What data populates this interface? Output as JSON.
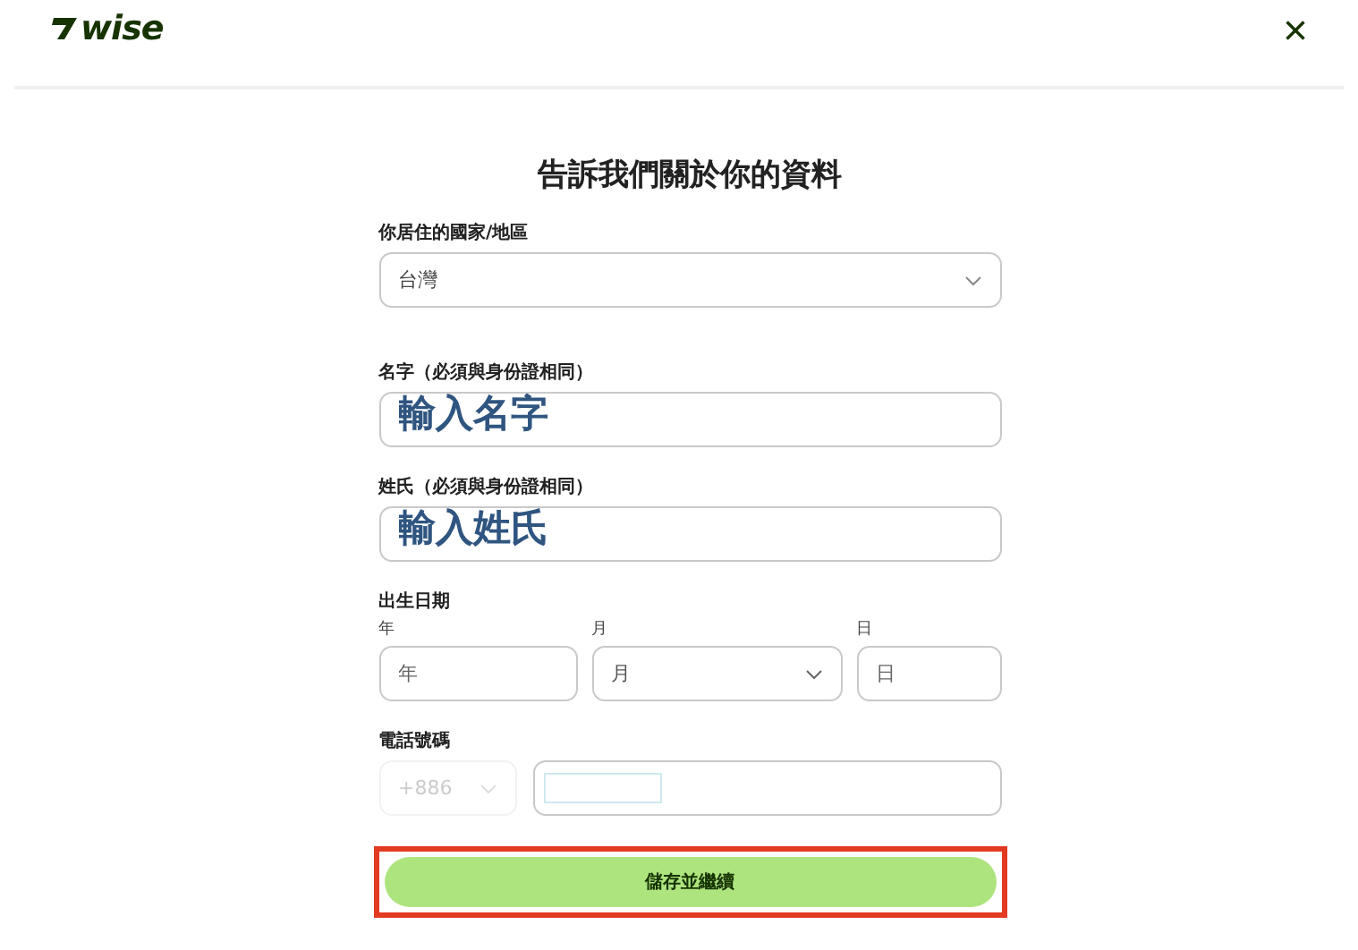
{
  "header": {
    "logo": "wise",
    "close": "×"
  },
  "title": "告訴我們關於你的資料",
  "country": {
    "label": "你居住的國家/地區",
    "value": "台灣"
  },
  "first_name": {
    "label": "名字（必須與身份證相同）",
    "placeholder": "輸入名字"
  },
  "last_name": {
    "label": "姓氏（必須與身份證相同）",
    "placeholder": "輸入姓氏"
  },
  "birth_date": {
    "label": "出生日期",
    "parts": [
      {
        "kind": "input",
        "label": "年",
        "placeholder": "年"
      },
      {
        "kind": "select",
        "label": "月",
        "placeholder": "月"
      },
      {
        "kind": "input",
        "label": "日",
        "placeholder": "日"
      }
    ]
  },
  "phone": {
    "label": "電話號碼",
    "code": "+886",
    "code_disabled": true
  },
  "submit": {
    "label": "儲存並繼續",
    "highlighted": true
  }
}
